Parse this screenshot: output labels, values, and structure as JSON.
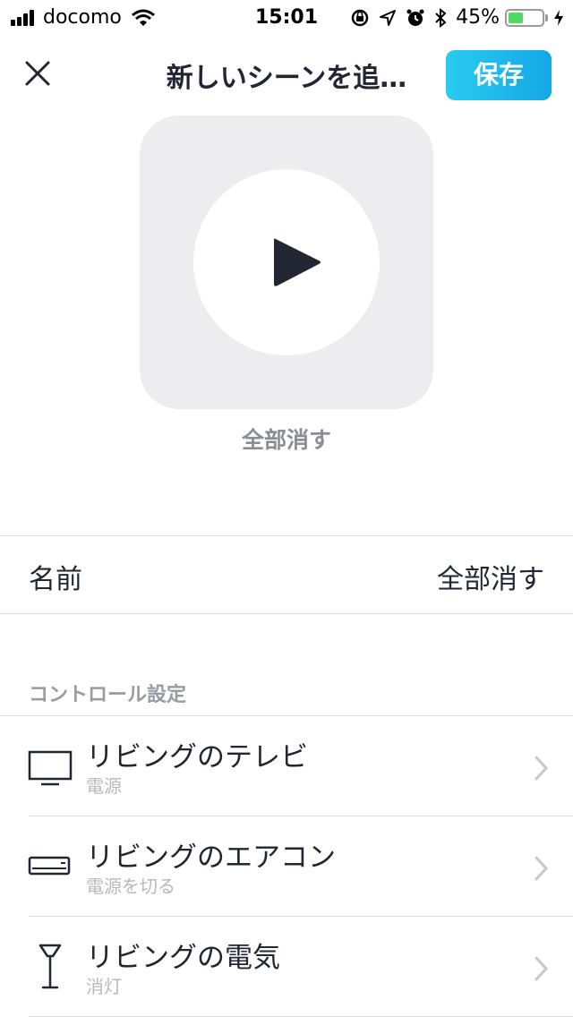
{
  "status_bar": {
    "carrier": "docomo",
    "time": "15:01",
    "battery_percent": "45%",
    "battery_level": 0.45
  },
  "nav": {
    "title": "新しいシーンを追…",
    "save_label": "保存"
  },
  "scene": {
    "caption": "全部消す"
  },
  "name_row": {
    "label": "名前",
    "value": "全部消す"
  },
  "controls": {
    "header": "コントロール設定",
    "items": [
      {
        "title": "リビングのテレビ",
        "subtitle": "電源",
        "icon": "tv-icon"
      },
      {
        "title": "リビングのエアコン",
        "subtitle": "電源を切る",
        "icon": "air-conditioner-icon"
      },
      {
        "title": "リビングの電気",
        "subtitle": "消灯",
        "icon": "floor-lamp-icon"
      }
    ]
  },
  "colors": {
    "accent": "#1cb8ec",
    "text": "#222633",
    "muted": "#8a8d94"
  }
}
